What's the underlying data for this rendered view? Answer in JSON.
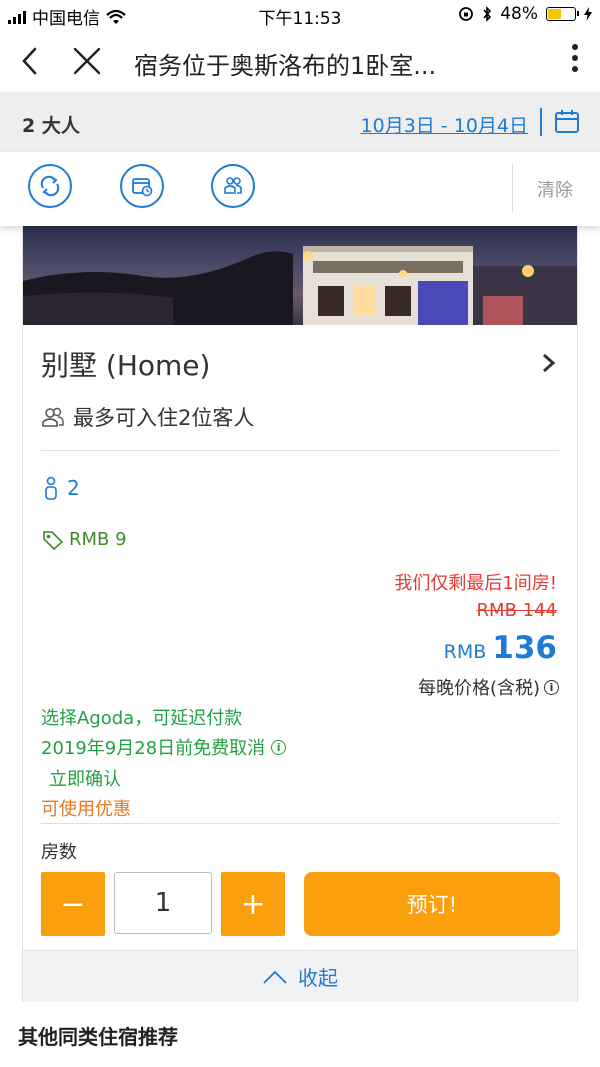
{
  "status_bar": {
    "carrier": "中国电信",
    "time": "下午11:53",
    "battery": "48%",
    "battery_level": 0.48
  },
  "nav": {
    "title": "宿务位于奥斯洛布的1卧室..."
  },
  "search": {
    "guests": "2 大人",
    "dates": "10月3日 - 10月4日"
  },
  "filters": {
    "clear_label": "清除",
    "buttons": [
      {
        "icon": "swap-icon"
      },
      {
        "icon": "calendar-clock-icon"
      },
      {
        "icon": "guests-icon"
      }
    ]
  },
  "room": {
    "name": "别墅 (Home)",
    "max_occupancy": "最多可入住2位客人",
    "guest_count": "2",
    "coupon": "RMB 9",
    "scarcity": "我们仅剩最后1间房!",
    "original_price": "RMB 144",
    "currency": "RMB",
    "price": "136",
    "price_note": "每晚价格(含税)",
    "pay_later": "选择Agoda，可延迟付款",
    "free_cancel": "2019年9月28日前免费取消",
    "instant_confirm": "立即确认",
    "promo": "可使用优惠",
    "rooms_label": "房数",
    "quantity": "1",
    "minus_label": "−",
    "plus_label": "+",
    "book_label": "预订!",
    "collapse_label": "收起"
  },
  "other_section_title": "其他同类住宿推荐",
  "colors": {
    "accent_blue": "#1f7ad4",
    "orange": "#fa9f0e",
    "red": "#e03c31",
    "green": "#22a044"
  }
}
